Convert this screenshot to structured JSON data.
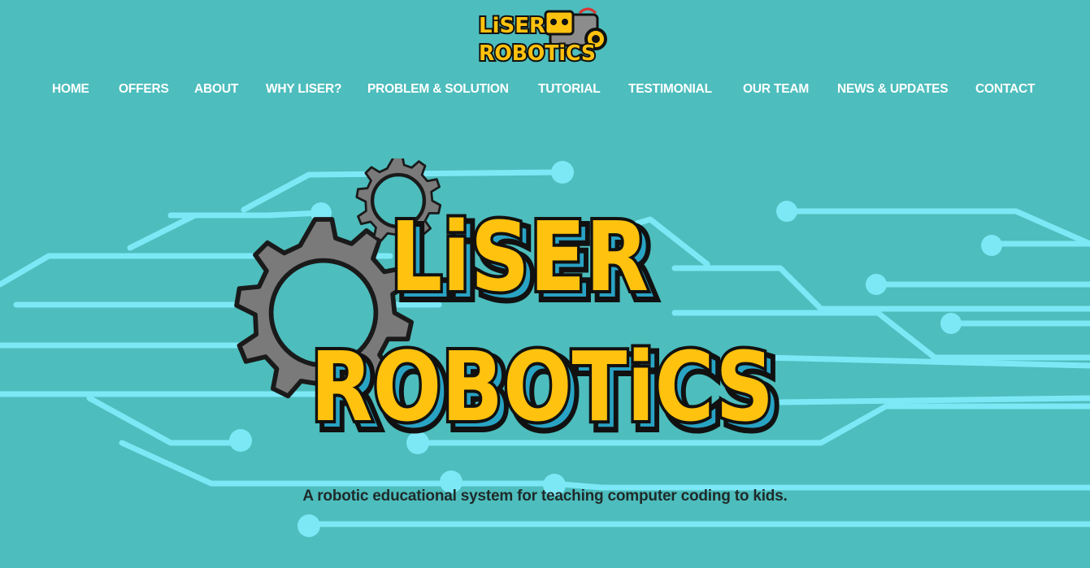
{
  "site": {
    "logo_line1": "LiSER",
    "logo_line2": "ROBOTiCS"
  },
  "nav": {
    "items": [
      {
        "label": "HOME"
      },
      {
        "label": "OFFERS"
      },
      {
        "label": "ABOUT"
      },
      {
        "label": "WHY LISER?"
      },
      {
        "label": "PROBLEM & SOLUTION"
      },
      {
        "label": "TUTORIAL"
      },
      {
        "label": "TESTIMONIAL"
      },
      {
        "label": "OUR TEAM"
      },
      {
        "label": "NEWS & UPDATES"
      },
      {
        "label": "CONTACT"
      }
    ]
  },
  "hero": {
    "logo_line1": "LiSER",
    "logo_line2": "ROBOTiCS",
    "tagline": "A robotic educational system for teaching computer coding to kids."
  },
  "colors": {
    "background": "#4dbdbd",
    "circuit": "#7de8f5",
    "logo_yellow": "#ffc20e",
    "logo_shadow": "#29a3c4",
    "gear": "#7a7a7a",
    "nav_text": "#ffffff"
  },
  "icons": {
    "large_gear": "gear-icon",
    "small_gear": "gear-icon",
    "robot": "robot-icon"
  }
}
